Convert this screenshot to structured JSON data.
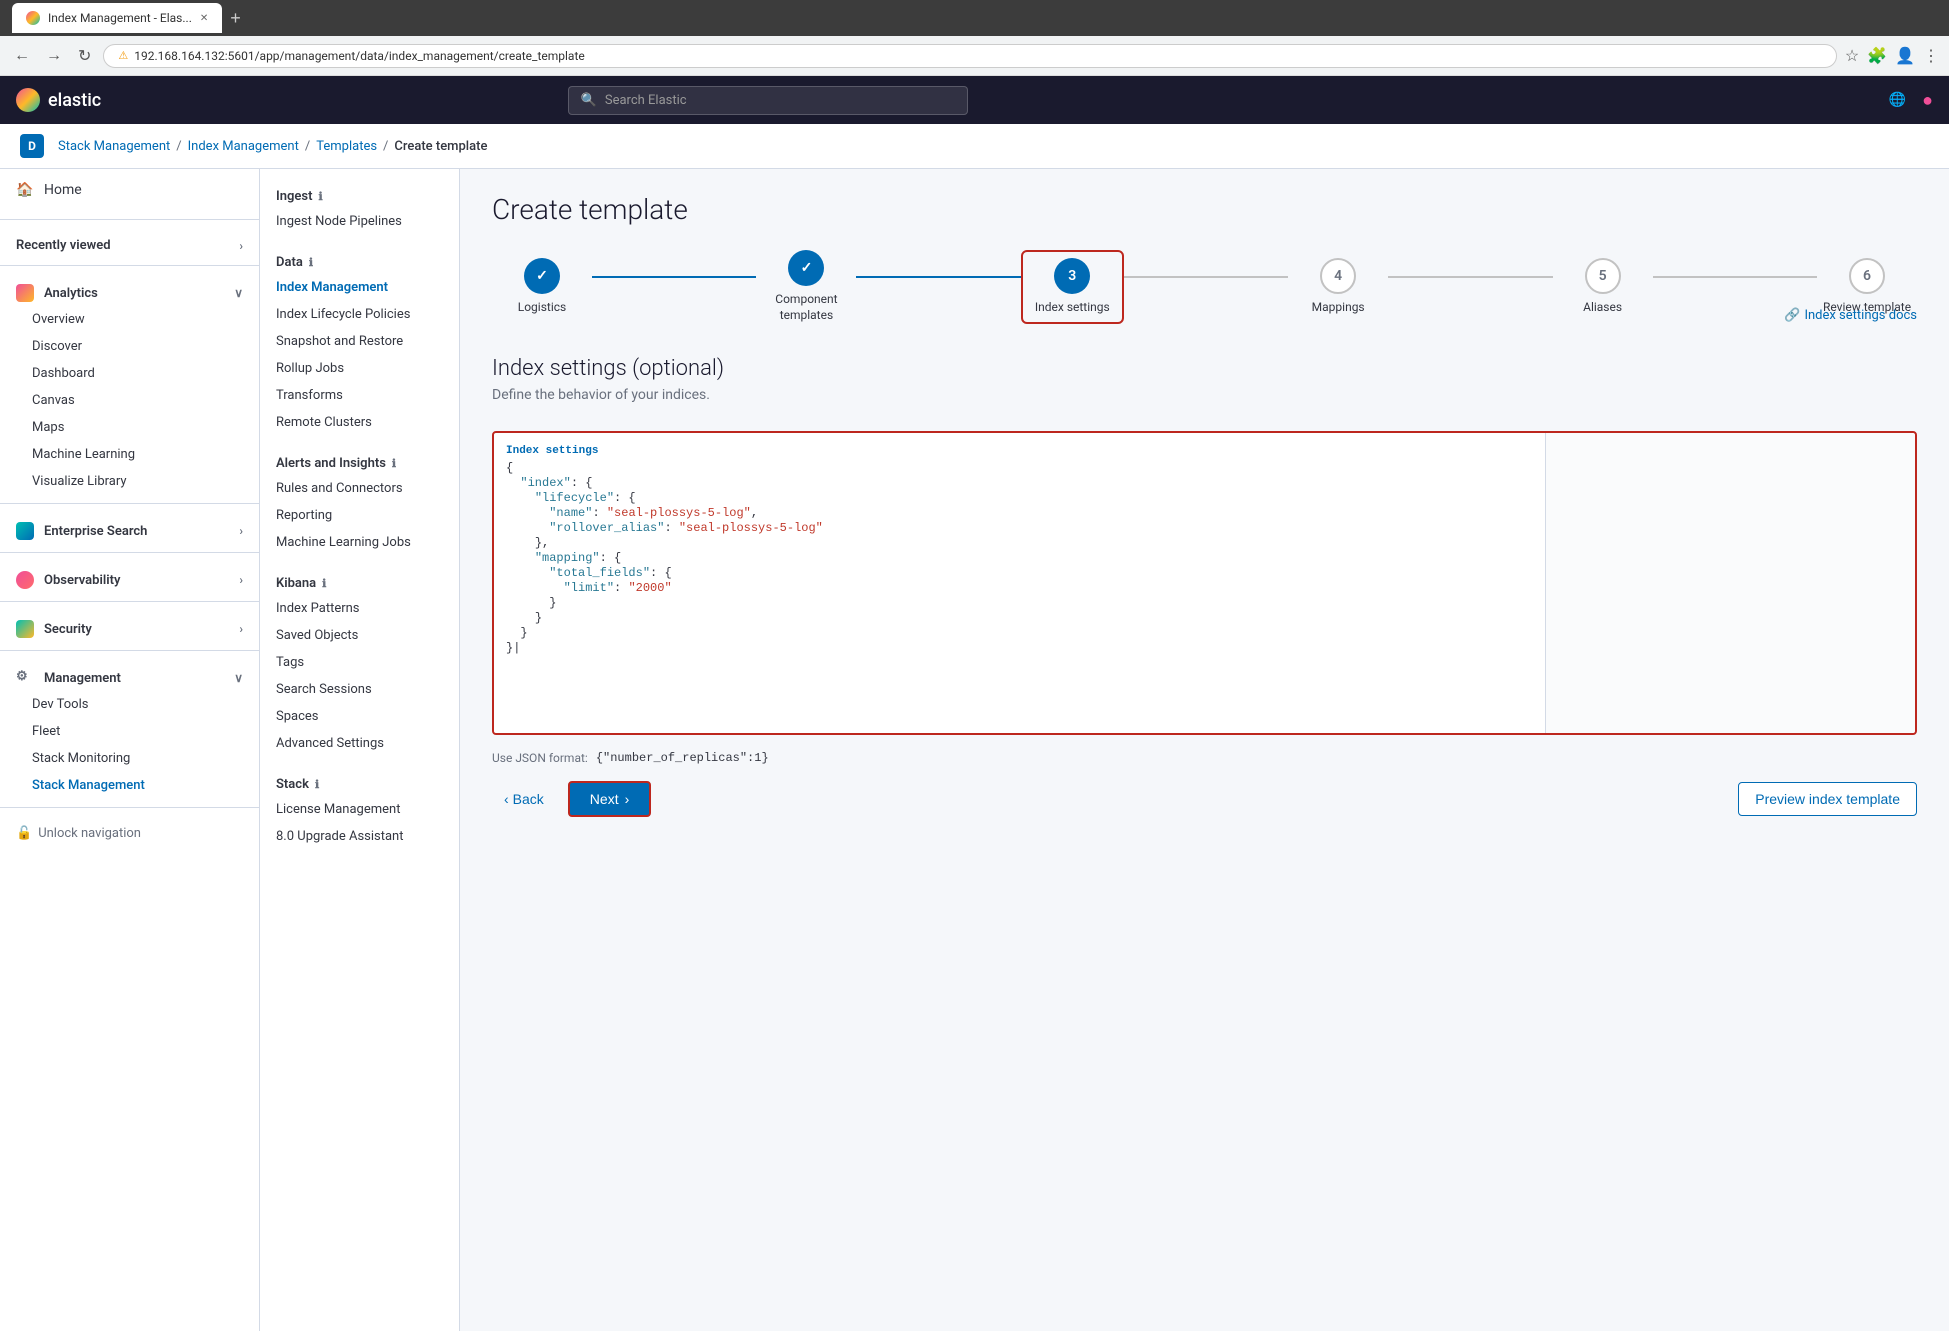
{
  "browser": {
    "tab_title": "Index Management - Elas...",
    "url": "192.168.164.132:5601/app/management/data/index_management/create_template",
    "url_prefix": "Not secure",
    "lock_icon": "⚠"
  },
  "header": {
    "logo_text": "elastic",
    "search_placeholder": "Search Elastic",
    "globe_icon": "🌐",
    "user_icon": "👤"
  },
  "breadcrumb": {
    "avatar_letter": "D",
    "items": [
      "Stack Management",
      "Index Management",
      "Templates",
      "Create template"
    ]
  },
  "sidebar": {
    "home_label": "Home",
    "recently_viewed_label": "Recently viewed",
    "analytics_label": "Analytics",
    "analytics_sub": [
      "Overview",
      "Discover",
      "Dashboard",
      "Canvas",
      "Maps",
      "Machine Learning",
      "Visualize Library"
    ],
    "enterprise_search_label": "Enterprise Search",
    "observability_label": "Observability",
    "security_label": "Security",
    "management_label": "Management",
    "management_sub": [
      "Dev Tools",
      "Fleet",
      "Stack Monitoring",
      "Stack Management"
    ],
    "unlock_nav_label": "Unlock navigation"
  },
  "nav_panel": {
    "ingest_title": "Ingest",
    "ingest_info": "ℹ",
    "ingest_items": [
      "Ingest Node Pipelines"
    ],
    "data_title": "Data",
    "data_info": "ℹ",
    "data_items": [
      "Index Management",
      "Index Lifecycle Policies",
      "Snapshot and Restore",
      "Rollup Jobs",
      "Transforms",
      "Remote Clusters"
    ],
    "alerts_title": "Alerts and Insights",
    "alerts_info": "ℹ",
    "alerts_items": [
      "Rules and Connectors",
      "Reporting",
      "Machine Learning Jobs"
    ],
    "kibana_title": "Kibana",
    "kibana_info": "ℹ",
    "kibana_items": [
      "Index Patterns",
      "Saved Objects",
      "Tags",
      "Search Sessions",
      "Spaces",
      "Advanced Settings"
    ],
    "stack_title": "Stack",
    "stack_info": "ℹ",
    "stack_items": [
      "License Management",
      "8.0 Upgrade Assistant"
    ]
  },
  "main": {
    "page_title": "Create template",
    "steps": [
      {
        "id": 1,
        "label": "Logistics",
        "state": "completed",
        "icon": "✓"
      },
      {
        "id": 2,
        "label": "Component\ntemplates",
        "state": "completed",
        "icon": "✓"
      },
      {
        "id": 3,
        "label": "Index settings",
        "state": "current",
        "icon": "3"
      },
      {
        "id": 4,
        "label": "Mappings",
        "state": "upcoming",
        "icon": "4"
      },
      {
        "id": 5,
        "label": "Aliases",
        "state": "upcoming",
        "icon": "5"
      },
      {
        "id": 6,
        "label": "Review template",
        "state": "upcoming",
        "icon": "6"
      }
    ],
    "section_title": "Index settings (optional)",
    "section_subtitle": "Define the behavior of your indices.",
    "docs_link_label": "Index settings docs",
    "code_label": "Index settings",
    "code_content": "{\n  \"index\": {\n    \"lifecycle\": {\n      \"name\": \"seal-plossys-5-log\",\n      \"rollover_alias\": \"seal-plossys-5-log\"\n    },\n    \"mapping\": {\n      \"total_fields\": {\n        \"limit\": \"2000\"\n      }\n    }\n  }\n}",
    "json_hint_label": "Use JSON format:",
    "json_hint_example": "{\"number_of_replicas\":1}",
    "btn_back_label": "Back",
    "btn_next_label": "Next",
    "btn_preview_label": "Preview index template"
  }
}
